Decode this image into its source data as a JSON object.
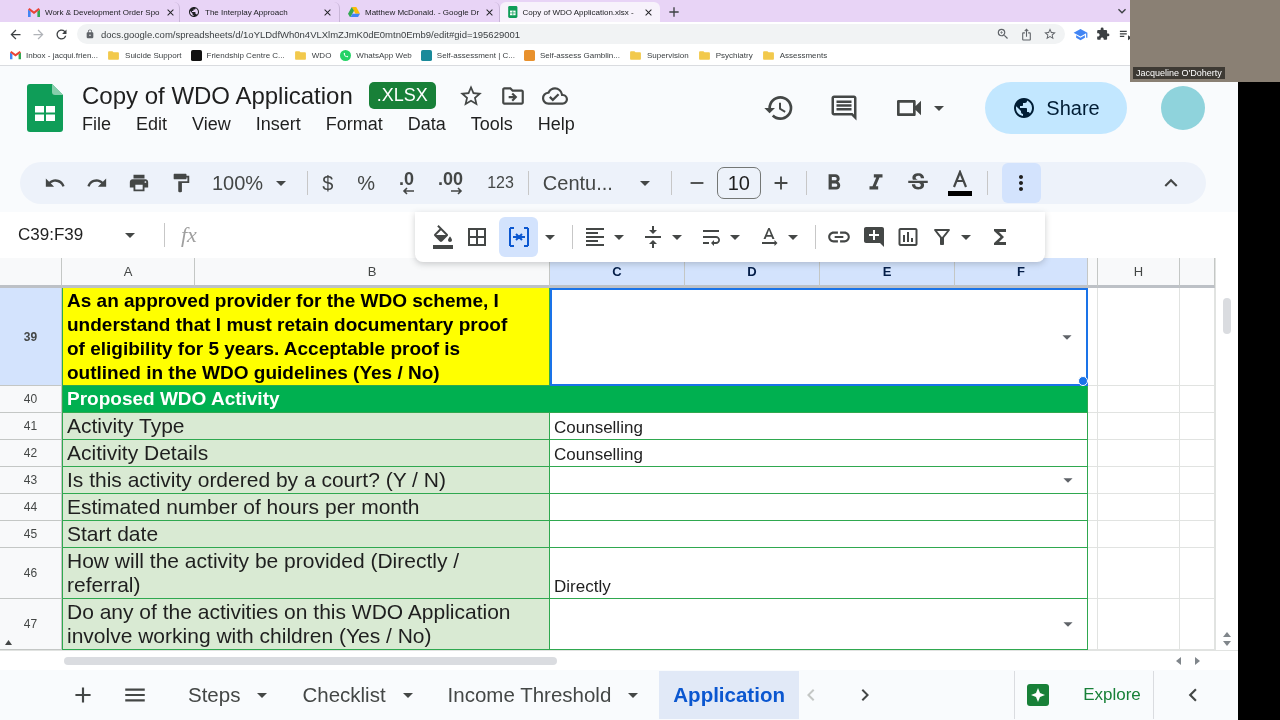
{
  "browser": {
    "tabs": [
      {
        "kind": "gmail",
        "title": "Work & Development Order Spo",
        "selected": false
      },
      {
        "kind": "globe",
        "title": "The Interplay Approach",
        "selected": false
      },
      {
        "kind": "drive",
        "title": "Matthew McDonald. - Google Dr",
        "selected": false
      },
      {
        "kind": "sheets",
        "title": "Copy of WDO Application.xlsx -",
        "selected": true
      }
    ],
    "url": "docs.google.com/spreadsheets/d/1oYLDdfWh0n4VLXlmZJmK0dE0mtn0Emb9/edit#gid=195629001",
    "bookmarks": [
      {
        "kind": "gmail",
        "label": "Inbox - jacqui.frien..."
      },
      {
        "kind": "folder",
        "label": "Suicide Support"
      },
      {
        "kind": "site",
        "color": "#111111",
        "label": "Friendship Centre C..."
      },
      {
        "kind": "folder",
        "label": "WDO"
      },
      {
        "kind": "whatsapp",
        "label": "WhatsApp Web"
      },
      {
        "kind": "site",
        "color": "#1a8a9a",
        "label": "Self-assessment | C..."
      },
      {
        "kind": "site",
        "color": "#e8912d",
        "label": "Self-assess Gamblin..."
      },
      {
        "kind": "folder",
        "label": "Supervision"
      },
      {
        "kind": "folder",
        "label": "Psychiatry"
      },
      {
        "kind": "folder",
        "label": "Assessments"
      }
    ]
  },
  "video_overlay": {
    "name": "Jacqueline O'Doherty"
  },
  "document": {
    "title": "Copy of WDO Application",
    "badge": ".XLSX",
    "menu": [
      "File",
      "Edit",
      "View",
      "Insert",
      "Format",
      "Data",
      "Tools",
      "Help"
    ],
    "share": "Share"
  },
  "toolbar": {
    "zoom": "100%",
    "currency": "$",
    "percent": "%",
    "decrease_decimals": ".0",
    "increase_decimals": ".00",
    "number_format": "123",
    "font": "Centu...",
    "font_size": "10",
    "more_open": true,
    "merge_active": true
  },
  "formula_bar": {
    "cell_range": "C39:F39",
    "fx": "fx"
  },
  "sheet": {
    "columns": [
      {
        "label": "A",
        "selected": false
      },
      {
        "label": "B",
        "selected": false
      },
      {
        "label": "C",
        "selected": true
      },
      {
        "label": "D",
        "selected": true
      },
      {
        "label": "E",
        "selected": true
      },
      {
        "label": "F",
        "selected": true
      },
      {
        "label": "H",
        "selected": false
      }
    ],
    "rows": [
      {
        "number": "39",
        "kind": "question",
        "selected": true,
        "label": "As an approved provider for the WDO scheme, I understand that I must retain documentary proof of eligibility for 5 years. Acceptable proof is outlined in the WDO guidelines (Yes / No)",
        "dropdown": true
      },
      {
        "number": "40",
        "kind": "section",
        "selected": false,
        "label": "Proposed WDO Activity"
      },
      {
        "number": "41",
        "kind": "field",
        "selected": false,
        "label": "Activity Type",
        "value": "Counselling",
        "dropdown": false
      },
      {
        "number": "42",
        "kind": "field",
        "selected": false,
        "label": "Acitivity Details",
        "value": "Counselling",
        "dropdown": false
      },
      {
        "number": "43",
        "kind": "field",
        "selected": false,
        "label": "Is this activity ordered by a court? (Y / N)",
        "dropdown": true
      },
      {
        "number": "44",
        "kind": "field",
        "selected": false,
        "label": "Estimated number of hours per month",
        "dropdown": false
      },
      {
        "number": "45",
        "kind": "field",
        "selected": false,
        "label": "Start date",
        "dropdown": false
      },
      {
        "number": "46",
        "kind": "field",
        "selected": false,
        "label": "How will the activity be provided (Directly / referral)",
        "value": "Directly",
        "dropdown": false
      },
      {
        "number": "47",
        "kind": "field",
        "selected": false,
        "label": "Do any of the activities on this WDO Application involve working with children (Yes / No)",
        "dropdown": true
      }
    ]
  },
  "sheet_tabs": {
    "tabs": [
      {
        "label": "Steps",
        "selected": false,
        "caret": true
      },
      {
        "label": "Checklist",
        "selected": false,
        "caret": true
      },
      {
        "label": "Income Threshold",
        "selected": false,
        "caret": true
      },
      {
        "label": "Application",
        "selected": true,
        "caret": false
      }
    ],
    "scroll_left_disabled": true,
    "explore": "Explore"
  }
}
